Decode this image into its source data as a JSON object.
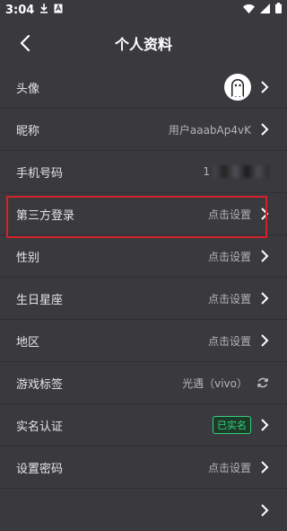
{
  "status_bar": {
    "time": "3:04",
    "left_icons": [
      "download-icon",
      "text-badge-icon"
    ],
    "right_icons": [
      "wifi-icon",
      "signal-icon",
      "battery-icon"
    ]
  },
  "header": {
    "title": "个人资料",
    "back_icon": "back-arrow-icon"
  },
  "rows": {
    "avatar": {
      "label": "头像"
    },
    "nickname": {
      "label": "昵称",
      "value": "用户aaabAp4vK"
    },
    "phone": {
      "label": "手机号码",
      "value_prefix": "1"
    },
    "third_party": {
      "label": "第三方登录",
      "value": "点击设置"
    },
    "gender": {
      "label": "性别",
      "value": "点击设置"
    },
    "birthday": {
      "label": "生日星座",
      "value": "点击设置"
    },
    "region": {
      "label": "地区",
      "value": "点击设置"
    },
    "game_tag": {
      "label": "游戏标签",
      "value": "光遇（vivo）"
    },
    "real_name": {
      "label": "实名认证",
      "badge": "已实名"
    },
    "password": {
      "label": "设置密码",
      "value": "点击设置"
    }
  },
  "colors": {
    "background": "#3a3a3e",
    "highlight": "#d3202a",
    "verified": "#2fd27a"
  }
}
